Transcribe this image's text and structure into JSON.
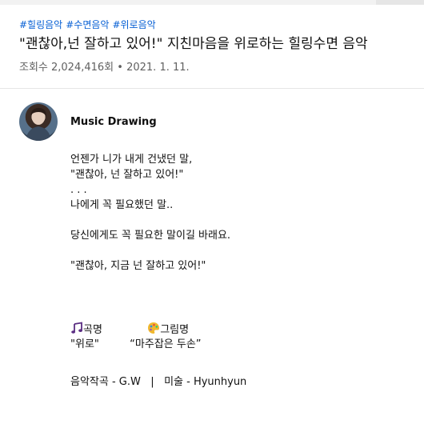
{
  "hashtags": [
    "#힐링음악",
    "#수면음악",
    "#위로음악"
  ],
  "title": "\"괜찮아,넌 잘하고 있어!\" 지친마음을 위로하는 힐링수면 음악",
  "meta": {
    "views": "조회수 2,024,416회",
    "sep": "•",
    "date": "2021. 1. 11."
  },
  "channel": {
    "name": "Music Drawing"
  },
  "description": {
    "lines": [
      "언젠가 니가 내게 건냈던 말,",
      "\"괜찮아, 넌 잘하고 있어!\"",
      ". . .",
      "나에게 꼭 필요했던 말..",
      "",
      "당신에게도 꼭 필요한 말이길 바래요.",
      "",
      "\"괜찮아, 지금 넌 잘하고 있어!\""
    ]
  },
  "credits": {
    "song_label": "곡명",
    "song_value": "\"위로\"",
    "art_label": "그림명",
    "art_value": "“마주잡은 두손”",
    "music_credit": "음악작곡 - G.W",
    "divider": "|",
    "art_credit": "미술 - Hyunhyun"
  },
  "icons": {
    "music": "musical-notes-icon",
    "art": "artist-palette-icon"
  }
}
